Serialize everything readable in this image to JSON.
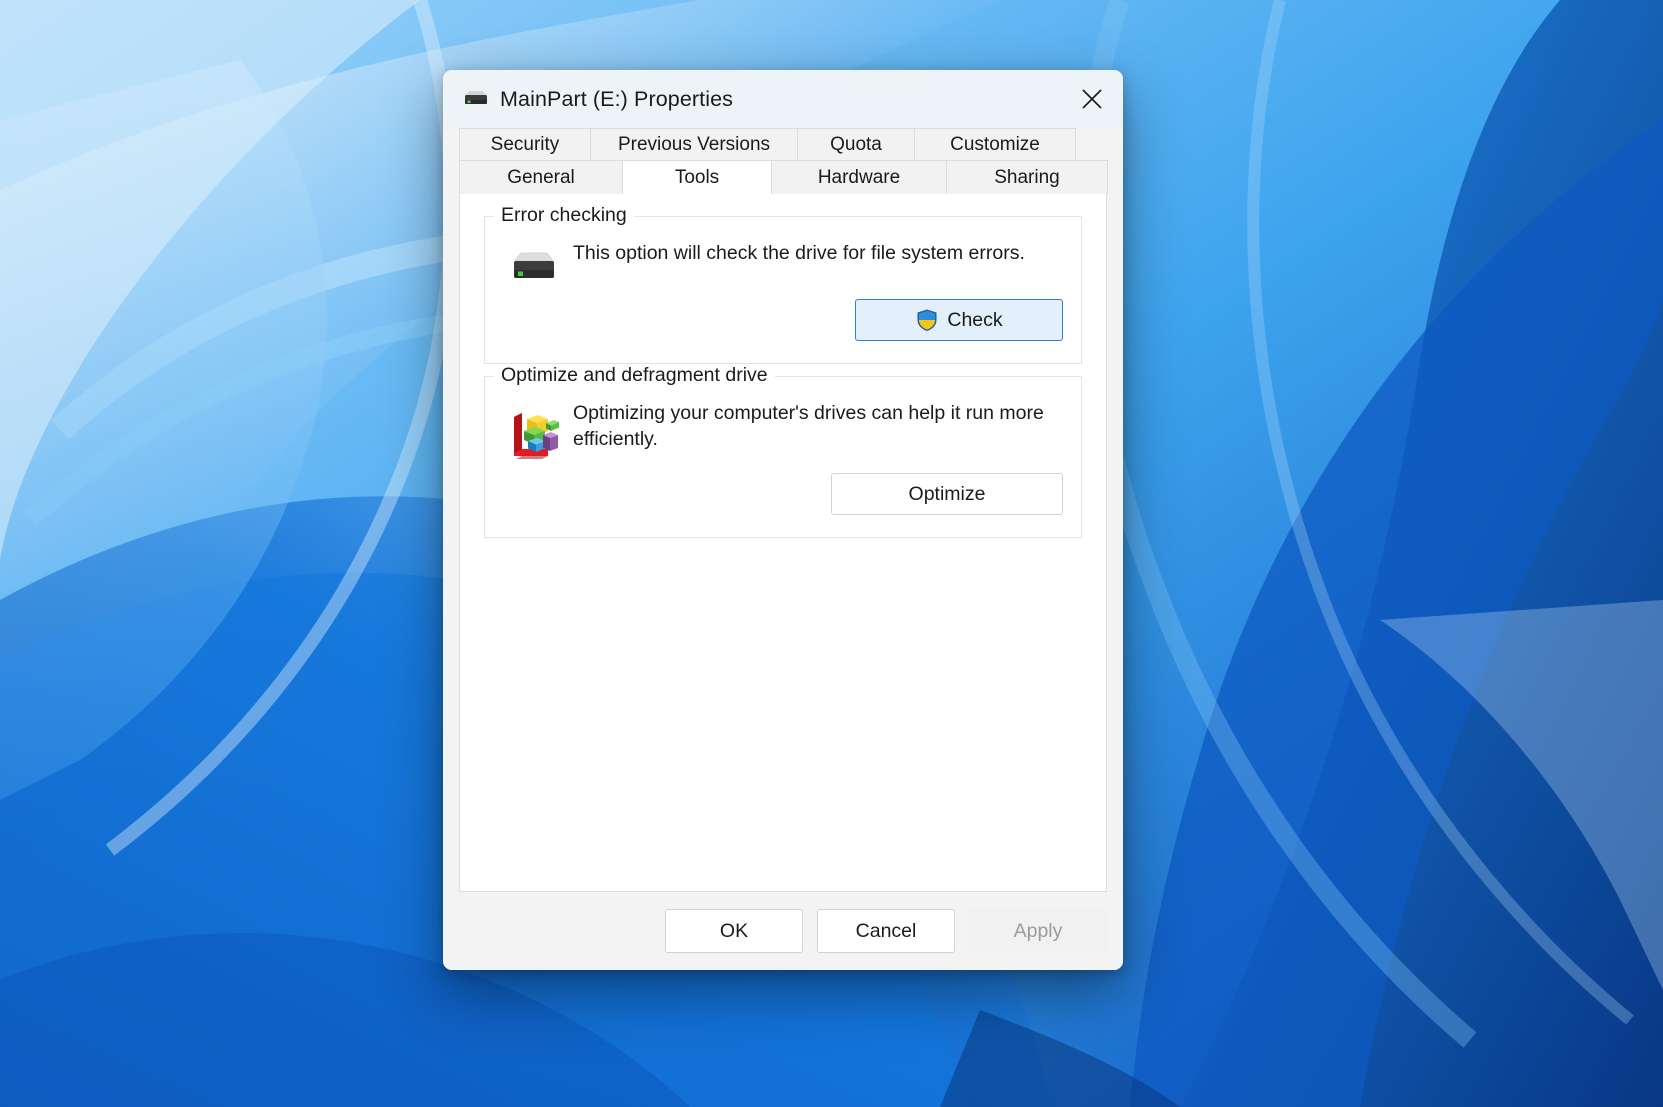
{
  "window": {
    "title": "MainPart (E:) Properties",
    "icon": "hard-drive-icon",
    "close_label": "Close"
  },
  "tabs": {
    "row1": [
      {
        "label": "Security",
        "selected": false
      },
      {
        "label": "Previous Versions",
        "selected": false
      },
      {
        "label": "Quota",
        "selected": false
      },
      {
        "label": "Customize",
        "selected": false
      }
    ],
    "row2": [
      {
        "label": "General",
        "selected": false
      },
      {
        "label": "Tools",
        "selected": true
      },
      {
        "label": "Hardware",
        "selected": false
      },
      {
        "label": "Sharing",
        "selected": false
      }
    ]
  },
  "error_checking": {
    "group_title": "Error checking",
    "description": "This option will check the drive for file system errors.",
    "button_label": "Check",
    "button_icon": "uac-shield-icon",
    "icon": "hard-drive-icon"
  },
  "optimize": {
    "group_title": "Optimize and defragment drive",
    "description": "Optimizing your computer's drives can help it run more efficiently.",
    "button_label": "Optimize",
    "icon": "defragment-icon"
  },
  "footer": {
    "ok_label": "OK",
    "cancel_label": "Cancel",
    "apply_label": "Apply",
    "apply_disabled": true
  },
  "colors": {
    "accent": "#2e7fd1",
    "dialog_bg": "#f3f3f3",
    "panel_bg": "#ffffff",
    "titlebar_bg": "#eef3f8",
    "text": "#1b1b1b",
    "disabled_text": "#9b9b9b",
    "shield_blue": "#2a8fd4",
    "shield_yellow": "#f5c518"
  }
}
